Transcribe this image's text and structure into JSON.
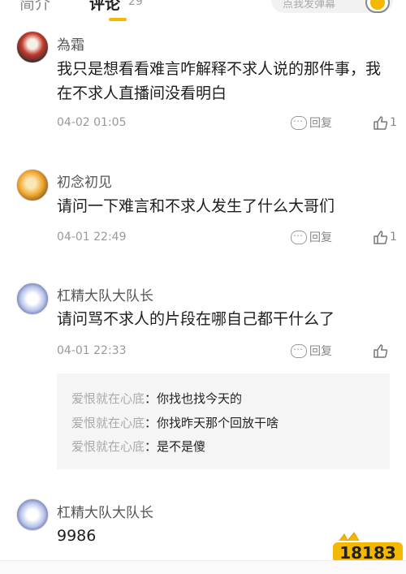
{
  "tabs": {
    "intro": "简介",
    "comments": "评论",
    "comments_count": "29"
  },
  "danmaku": {
    "placeholder": "点我发弹幕",
    "toggle_label": "弹"
  },
  "comments": [
    {
      "username": "為霜",
      "content": "我只是想看看难言咋解释不求人说的那件事，我在不求人直播间没看明白",
      "time": "04-02 01:05",
      "reply_label": "回复",
      "likes": "1"
    },
    {
      "username": "初念初见",
      "content": "请问一下难言和不求人发生了什么大哥们",
      "time": "04-01 22:49",
      "reply_label": "回复",
      "likes": "1"
    },
    {
      "username": "杠精大队大队长",
      "content": "请问骂不求人的片段在哪自己都干什么了",
      "time": "04-01 22:33",
      "reply_label": "回复",
      "likes": "",
      "replies": [
        {
          "author": "爱恨就在心底",
          "text": "你找也找今天的"
        },
        {
          "author": "爱恨就在心底",
          "text": "你找昨天那个回放干啥"
        },
        {
          "author": "爱恨就在心底",
          "text": "是不是傻"
        }
      ]
    },
    {
      "username": "杠精大队大队长",
      "content": "9986"
    }
  ],
  "watermark": {
    "text": "18183"
  },
  "colors": {
    "accent": "#f5b800",
    "text_secondary": "#999999",
    "reply_bg": "#f5f5f5"
  }
}
